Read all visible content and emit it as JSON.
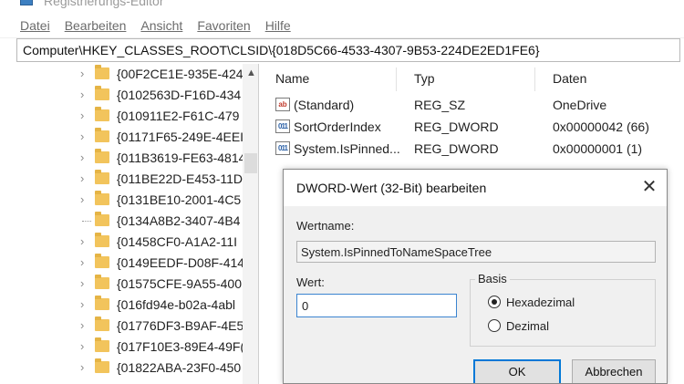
{
  "window": {
    "title": "Registrierungs-Editor"
  },
  "menu": [
    "Datei",
    "Bearbeiten",
    "Ansicht",
    "Favoriten",
    "Hilfe"
  ],
  "address": "Computer\\HKEY_CLASSES_ROOT\\CLSID\\{018D5C66-4533-4307-9B53-224DE2ED1FE6}",
  "tree": {
    "items": [
      "{00F2CE1E-935E-424",
      "{0102563D-F16D-434",
      "{010911E2-F61C-479",
      "{01171F65-249E-4EEI",
      "{011B3619-FE63-4814",
      "{011BE22D-E453-11D",
      "{0131BE10-2001-4C5",
      "{0134A8B2-3407-4B4",
      "{01458CF0-A1A2-11I",
      "{0149EEDF-D08F-414",
      "{01575CFE-9A55-400",
      "{016fd94e-b02a-4abl",
      "{01776DF3-B9AF-4E5",
      "{017F10E3-89E4-49F(",
      "{01822ABA-23F0-450"
    ]
  },
  "values_table": {
    "columns": [
      "Name",
      "Typ",
      "Daten"
    ],
    "rows": [
      {
        "icon": "string-value-icon",
        "name": "(Standard)",
        "type": "REG_SZ",
        "data": "OneDrive"
      },
      {
        "icon": "binary-value-icon",
        "name": "SortOrderIndex",
        "type": "REG_DWORD",
        "data": "0x00000042 (66)"
      },
      {
        "icon": "binary-value-icon",
        "name": "System.IsPinned...",
        "type": "REG_DWORD",
        "data": "0x00000001 (1)"
      }
    ]
  },
  "dialog": {
    "title": "DWORD-Wert (32-Bit) bearbeiten",
    "close_label": "✕",
    "name_label": "Wertname:",
    "name_value": "System.IsPinnedToNameSpaceTree",
    "value_label": "Wert:",
    "value": "0",
    "base_label": "Basis",
    "base_options": [
      {
        "label": "Hexadezimal",
        "selected": true
      },
      {
        "label": "Dezimal",
        "selected": false
      }
    ],
    "ok_label": "OK",
    "cancel_label": "Abbrechen"
  }
}
